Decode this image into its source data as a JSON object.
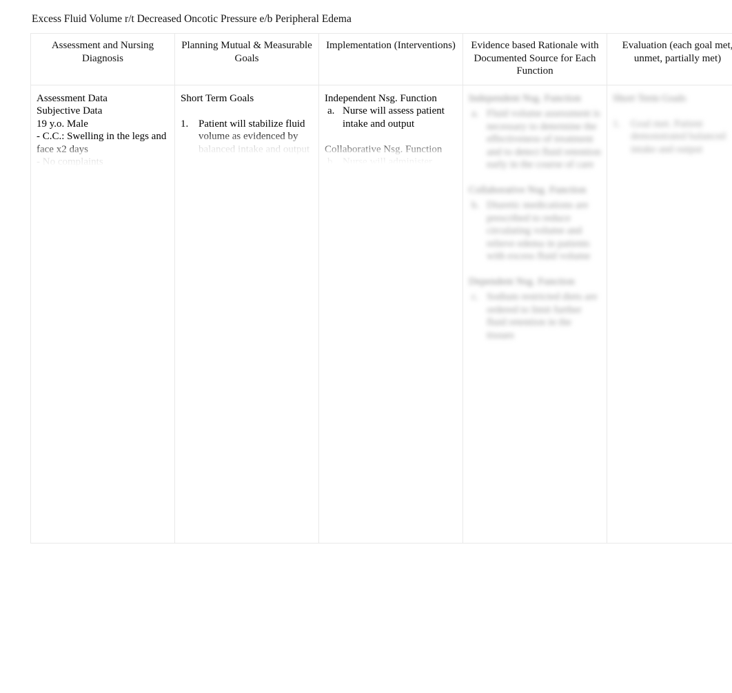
{
  "document": {
    "title": "Excess Fluid Volume r/t Decreased Oncotic Pressure e/b Peripheral Edema"
  },
  "table": {
    "headers": [
      "Assessment and Nursing Diagnosis",
      "Planning Mutual & Measurable Goals",
      "Implementation (Interventions)",
      "Evidence based Rationale with Documented Source for Each Function",
      "Evaluation (each goal met, unmet, partially met)"
    ],
    "columns": {
      "assessment": {
        "heading_1": "Assessment Data",
        "heading_2": "Subjective Data",
        "line_1": "19 y.o. Male",
        "line_2": "- C.C.: Swelling in the legs and face x2 days",
        "line_3": "- No complaints"
      },
      "planning": {
        "heading_1": "Short Term Goals",
        "goal_1_marker": "1.",
        "goal_1_text": "Patient will stabilize fluid volume as evidenced by balanced intake and output"
      },
      "implementation": {
        "heading_1": "Independent Nsg. Function",
        "item_a_marker": "a.",
        "item_a_text": "Nurse will assess patient intake and output",
        "heading_2": "Collaborative Nsg. Function",
        "item_b_marker": "b.",
        "item_b_text": "Nurse will administer"
      },
      "rationale": {
        "heading_1": "Independent Nsg. Function",
        "item_a_marker": "a.",
        "item_a_text": "Fluid volume assessment is necessary to determine the effectiveness of treatment and to detect fluid retention early in the course of care",
        "heading_2": "Collaborative Nsg. Function",
        "item_b_marker": "b.",
        "item_b_text": "Diuretic medications are prescribed to reduce circulating volume and relieve edema in patients with excess fluid volume",
        "heading_3": "Dependent Nsg. Function",
        "item_c_marker": "c.",
        "item_c_text": "Sodium restricted diets are ordered to limit further fluid retention in the tissues"
      },
      "evaluation": {
        "heading_1": "Short Term Goals",
        "item_1_marker": "1.",
        "item_1_text": "Goal met. Patient demonstrated balanced intake and output"
      }
    }
  },
  "style": {
    "border_color": "#e8e8e8",
    "text_color": "#111111",
    "redacted_color": "#9a9a9a",
    "background": "#ffffff"
  }
}
